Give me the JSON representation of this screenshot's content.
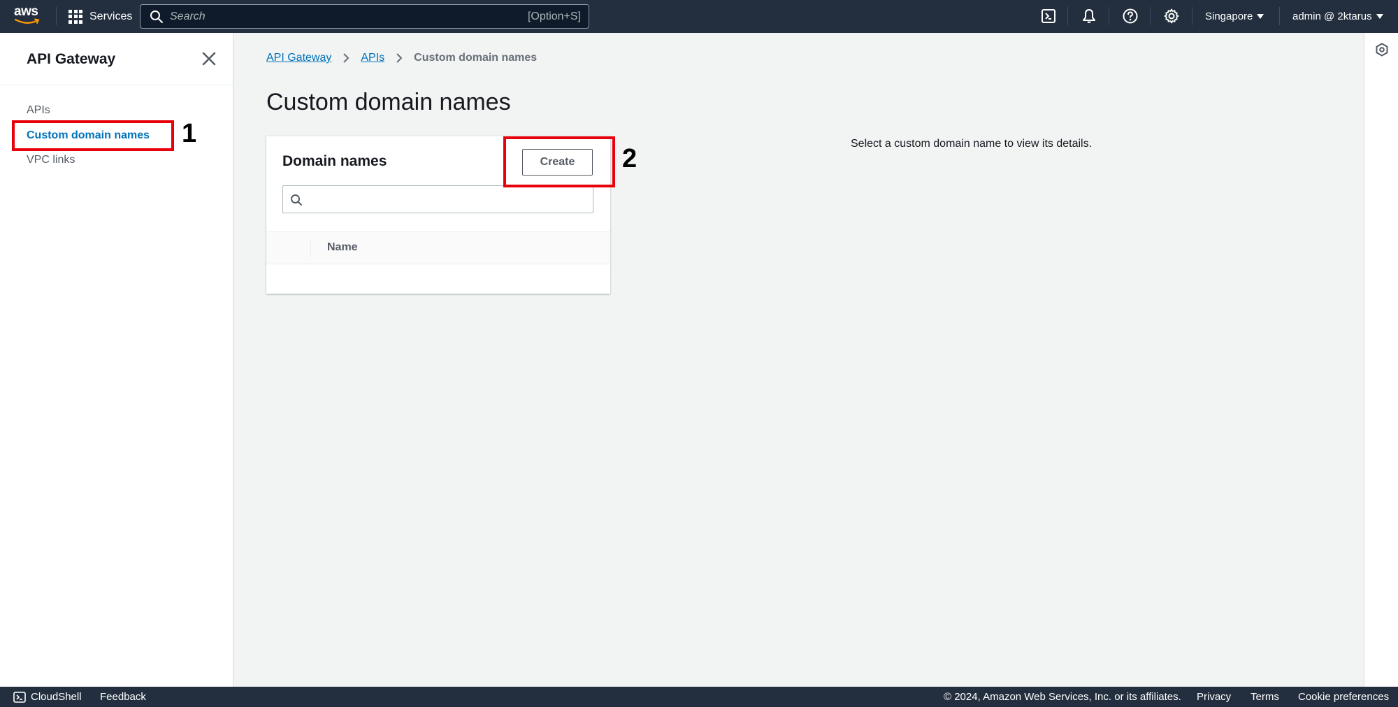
{
  "topnav": {
    "logo_text": "aws",
    "services_label": "Services",
    "search_placeholder": "Search",
    "search_shortcut": "[Option+S]",
    "region_label": "Singapore",
    "account_label": "admin @ 2ktarus",
    "icons": [
      "cloudshell-icon",
      "bell-icon",
      "help-icon",
      "settings-icon"
    ]
  },
  "sidebar": {
    "title": "API Gateway",
    "items": [
      {
        "label": "APIs",
        "active": false
      },
      {
        "label": "Custom domain names",
        "active": true
      },
      {
        "label": "VPC links",
        "active": false
      }
    ]
  },
  "breadcrumb": {
    "items": [
      "API Gateway",
      "APIs"
    ],
    "current": "Custom domain names"
  },
  "main": {
    "page_title": "Custom domain names",
    "panel_title": "Domain names",
    "create_label": "Create",
    "search_value": "",
    "table_columns": [
      "Name"
    ],
    "table_rows": [],
    "detail_hint": "Select a custom domain name to view its details."
  },
  "annotations": [
    {
      "number": "1",
      "color": "#e8000b"
    },
    {
      "number": "2",
      "color": "#e8000b"
    }
  ],
  "footer": {
    "cloudshell_label": "CloudShell",
    "feedback_label": "Feedback",
    "copyright": "© 2024, Amazon Web Services, Inc. or its affiliates.",
    "privacy_label": "Privacy",
    "terms_label": "Terms",
    "cookie_label": "Cookie preferences"
  },
  "colors": {
    "nav_bg": "#232f3e",
    "link": "#0073bb",
    "annotation": "#e8000b"
  }
}
